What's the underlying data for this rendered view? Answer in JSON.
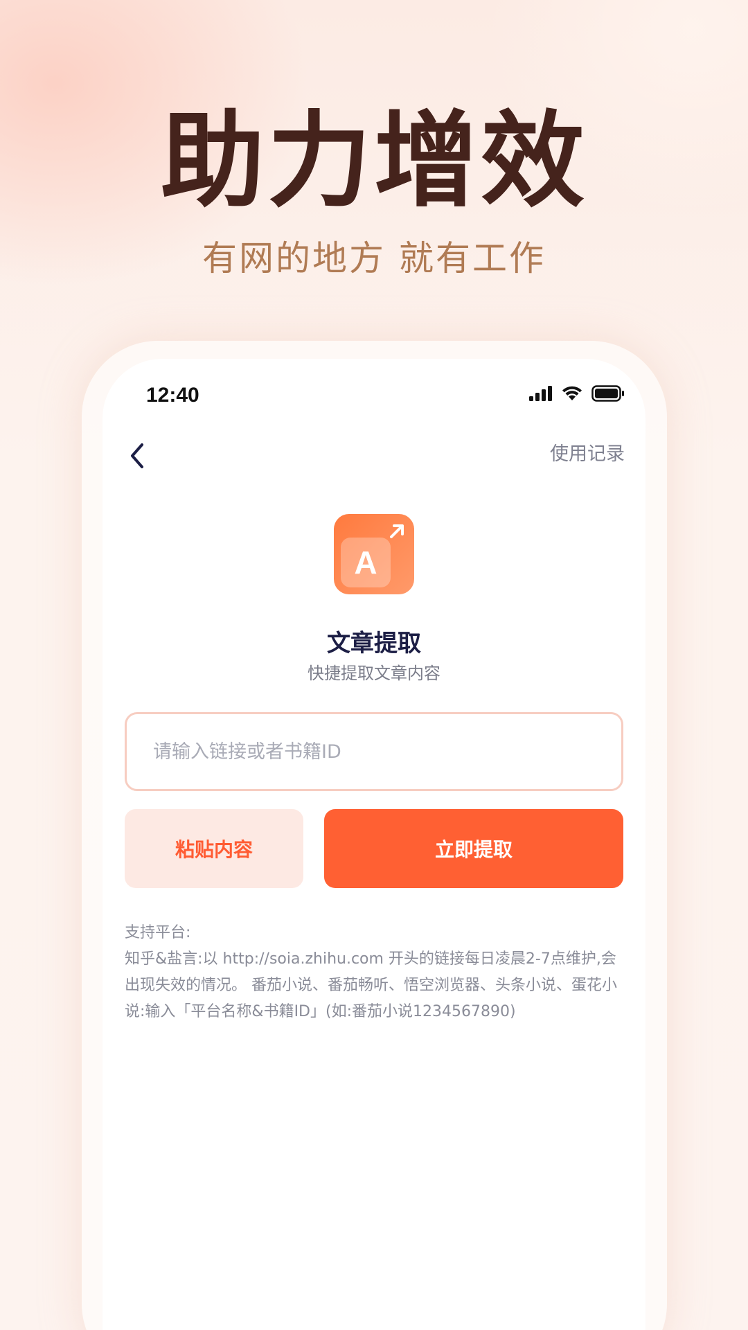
{
  "hero": {
    "title": "助力增效",
    "subtitle": "有网的地方 就有工作"
  },
  "status_bar": {
    "time": "12:40"
  },
  "nav": {
    "history_label": "使用记录"
  },
  "app_icon": {
    "letter": "A"
  },
  "feature": {
    "title": "文章提取",
    "subtitle": "快捷提取文章内容"
  },
  "input": {
    "value": "",
    "placeholder": "请输入链接或者书籍ID"
  },
  "buttons": {
    "paste_label": "粘贴内容",
    "extract_label": "立即提取"
  },
  "support": {
    "heading": "支持平台:",
    "text": "知乎&盐言:以 http://soia.zhihu.com 开头的链接每日凌晨2-7点维护,会出现失效的情况。 番茄小说、番茄畅听、悟空浏览器、头条小说、蛋花小说:输入「平台名称&书籍ID」(如:番茄小说1234567890)"
  },
  "colors": {
    "accent": "#ff6033",
    "accent_light": "#fde9e3",
    "title_dark": "#45231c",
    "subtitle_brown": "#b07b54"
  }
}
